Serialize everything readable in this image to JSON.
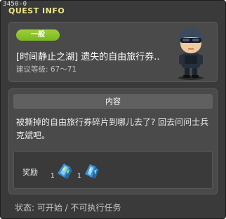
{
  "window": {
    "corner_id": "3450-0",
    "title": "QUEST INFO"
  },
  "quest": {
    "category_badge": "一般",
    "name": "[时间静止之湖] 遗失的自由旅行券..",
    "level_range": "建议等级: 67～71"
  },
  "content": {
    "header": "内容",
    "description": "被撕掉的自由旅行券碎片到哪儿去了? 回去问问士兵克斌吧。"
  },
  "rewards": {
    "label": "奖励",
    "items": [
      {
        "icon": "ticket-fragment-icon",
        "quantity": "1"
      },
      {
        "icon": "ticket-fragment-icon",
        "quantity": "1"
      }
    ]
  },
  "status": {
    "text": "状态: 可开始 / 不可执行任务"
  },
  "colors": {
    "badge": "#8cc42c",
    "title": "#f0e68a",
    "background": "#3a3a3a"
  }
}
